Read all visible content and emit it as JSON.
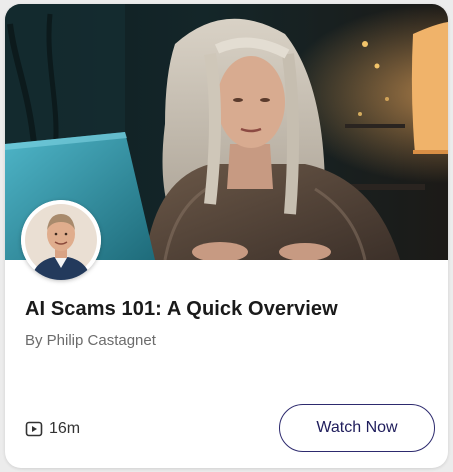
{
  "card": {
    "title": "AI Scams 101: A Quick Overview",
    "author": "By Philip Castagnet",
    "duration": "16m",
    "watch_button_label": "Watch Now"
  },
  "icons": {
    "duration": "play-icon"
  },
  "colors": {
    "button_border": "#2d2a6e",
    "button_text": "#1f1d5c",
    "title": "#1a1a1a",
    "author": "#6b6b6b"
  }
}
